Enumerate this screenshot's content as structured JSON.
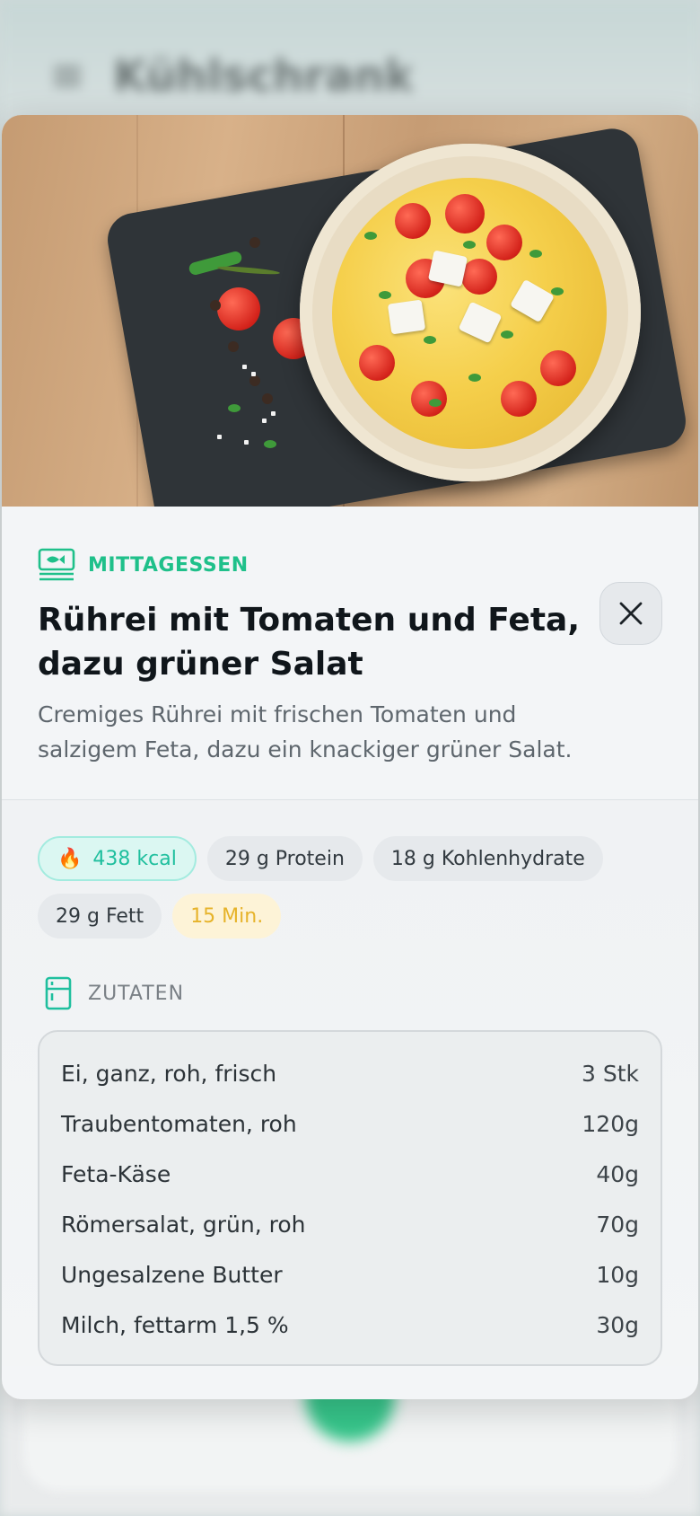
{
  "background": {
    "title": "Kühlschrank"
  },
  "recipe": {
    "category": "MITTAGESSEN",
    "title": "Rührei mit Tomaten und Feta, dazu grüner Salat",
    "description": "Cremiges Rührei mit frischen Tomaten und salzigem Feta, dazu ein knackiger grüner Salat.",
    "close_icon": "close-icon",
    "chips": {
      "kcal": "438 kcal",
      "protein": "29 g Protein",
      "carbs": "18 g Kohlenhydrate",
      "fat": "29 g Fett",
      "time": "15 Min."
    },
    "ingredients_label": "ZUTATEN",
    "ingredients": [
      {
        "name": "Ei, ganz, roh, frisch",
        "amount": "3 Stk"
      },
      {
        "name": "Traubentomaten, roh",
        "amount": "120g"
      },
      {
        "name": "Feta-Käse",
        "amount": "40g"
      },
      {
        "name": "Römersalat, grün, roh",
        "amount": "70g"
      },
      {
        "name": "Ungesalzene Butter",
        "amount": "10g"
      },
      {
        "name": "Milch, fettarm 1,5 %",
        "amount": "30g"
      }
    ]
  },
  "colors": {
    "accent": "#1fc08a",
    "kcal": "#1fbf9e",
    "time": "#e6b32a"
  }
}
